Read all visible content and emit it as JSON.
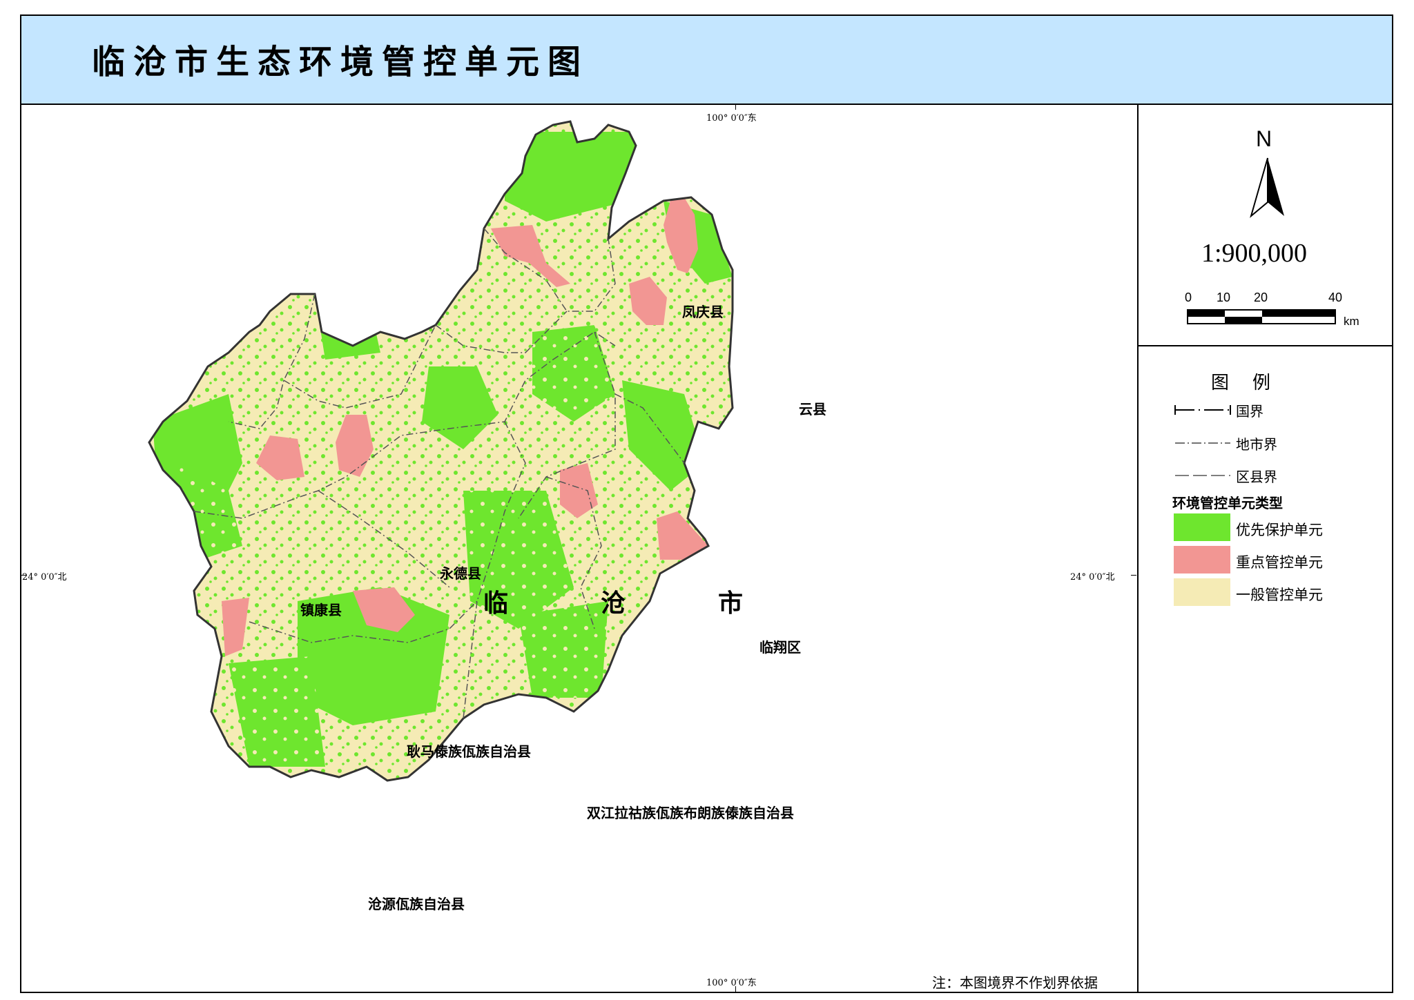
{
  "title": "临沧市生态环境管控单元图",
  "coordinates": {
    "top_lon": "100° 0′0″东",
    "bottom_lon": "100° 0′0″东",
    "left_lat": "24° 0′0″北",
    "right_lat": "24° 0′0″北"
  },
  "map": {
    "city_chars": [
      "临",
      "沧",
      "市"
    ],
    "counties": [
      {
        "name": "凤庆县"
      },
      {
        "name": "云县"
      },
      {
        "name": "永德县"
      },
      {
        "name": "镇康县"
      },
      {
        "name": "临翔区"
      },
      {
        "name": "耿马傣族佤族自治县"
      },
      {
        "name": "双江拉祜族佤族布朗族傣族自治县"
      },
      {
        "name": "沧源佤族自治县"
      }
    ],
    "colors": {
      "priority_protection": "#6ee62e",
      "key_control": "#f29693",
      "general_control": "#f5ebb5"
    }
  },
  "north_arrow": {
    "label": "N",
    "icon": "north-arrow-icon"
  },
  "scale": {
    "ratio": "1:900,000",
    "ticks": [
      "0",
      "10",
      "20",
      "40"
    ],
    "unit": "km"
  },
  "legend": {
    "title": "图例",
    "line_items": [
      {
        "label": "国界",
        "icon": "national-boundary-icon"
      },
      {
        "label": "地市界",
        "icon": "city-boundary-icon"
      },
      {
        "label": "区县界",
        "icon": "county-boundary-icon"
      }
    ],
    "section_title": "环境管控单元类型",
    "fill_items": [
      {
        "label": "优先保护单元",
        "color": "#6ee62e"
      },
      {
        "label": "重点管控单元",
        "color": "#f29693"
      },
      {
        "label": "一般管控单元",
        "color": "#f5ebb5"
      }
    ]
  },
  "note": "注：本图境界不作划界依据"
}
